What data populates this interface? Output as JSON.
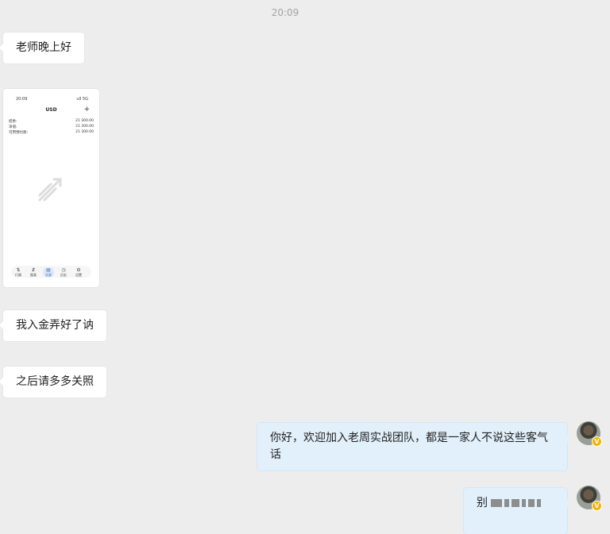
{
  "timestamp": "20:09",
  "messages": {
    "m1": "老师晚上好",
    "m3": "我入金弄好了讷",
    "m4": "之后请多多关照",
    "m5": "你好，欢迎加入老周实战团队，都是一家人不说这些客气话",
    "m6": "别"
  },
  "phone_screenshot": {
    "status_time": "20:09",
    "status_icons": "ull 5G",
    "currency": "USD",
    "plus": "+",
    "rows": [
      {
        "label": "结余:",
        "value": "21 300.00"
      },
      {
        "label": "净值:",
        "value": "21 300.00"
      },
      {
        "label": "可用预付款:",
        "value": "21 300.00"
      }
    ],
    "nav": [
      {
        "glyph": "⇅",
        "label": "行情"
      },
      {
        "glyph": "⇵",
        "label": "图表"
      },
      {
        "glyph": "▤",
        "label": "交易"
      },
      {
        "glyph": "◷",
        "label": "历史"
      },
      {
        "glyph": "⚙",
        "label": "设置"
      }
    ]
  },
  "avatar_badge": "V"
}
